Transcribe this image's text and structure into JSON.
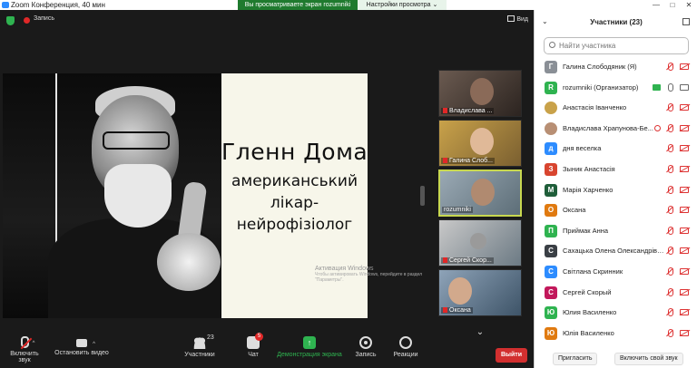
{
  "window": {
    "title": "Zoom Конференция, 40 мин",
    "controls": [
      "—",
      "□",
      "✕"
    ]
  },
  "share_banner": {
    "text": "Вы просматриваете экран rozumniki",
    "options_label": "Настройки просмотра ⌄"
  },
  "topbar": {
    "record_label": "Запись",
    "view_label": "Вид"
  },
  "slide": {
    "title": "Гленн Доман",
    "subtitle_lines": [
      "американський",
      "лікар-",
      "нейрофізіолог"
    ],
    "watermark_title": "Активация Windows",
    "watermark_text": "Чтобы активировать Windows, перейдите в раздел \"Параметры\"."
  },
  "thumbnails": [
    {
      "name": "Владислава ...",
      "muted": true
    },
    {
      "name": "Галина Слоб...",
      "muted": true
    },
    {
      "name": "rozumniki",
      "muted": false,
      "active": true
    },
    {
      "name": "Сергей Скор...",
      "muted": true
    },
    {
      "name": "Оксана",
      "muted": true
    }
  ],
  "toolbar": {
    "mute_label": "Включить звук",
    "video_label": "Остановить видео",
    "participants_label": "Участники",
    "participants_count": "23",
    "chat_label": "Чат",
    "chat_badge": "5",
    "share_label": "Демонстрация экрана",
    "record_label": "Запись",
    "reactions_label": "Реакции",
    "leave_label": "Выйти",
    "share_icon": "↑"
  },
  "panel": {
    "title": "Участники (23)",
    "search_placeholder": "Найти участника",
    "invite_label": "Пригласить",
    "unmute_label": "Включить свой звук",
    "participants": [
      {
        "initial": "Г",
        "name": "Галина Слободяник (Я)",
        "color": "#8a8f96",
        "mic": "off",
        "video": "off"
      },
      {
        "initial": "R",
        "name": "rozumniki (Организатор)",
        "color": "#2fb350",
        "mic": "on",
        "video": "on",
        "sharing": true
      },
      {
        "initial": "",
        "name": "Анастасія Іванченко",
        "color": "#c9a24a",
        "mic": "off",
        "video": "off",
        "photo": true
      },
      {
        "initial": "",
        "name": "Владислава Храпунова-Бе...",
        "color": "#b88f74",
        "mic": "off",
        "video": "off",
        "photo": true,
        "recording": true
      },
      {
        "initial": "д",
        "name": "дня веселка",
        "color": "#2d8cff",
        "mic": "off",
        "video": "off"
      },
      {
        "initial": "З",
        "name": "Зыник Анастасія",
        "color": "#d8452f",
        "mic": "off",
        "video": "off"
      },
      {
        "initial": "М",
        "name": "Марія Харченко",
        "color": "#1f5e3a",
        "mic": "off",
        "video": "off"
      },
      {
        "initial": "О",
        "name": "Оксана",
        "color": "#e07a10",
        "mic": "off",
        "video": "off"
      },
      {
        "initial": "П",
        "name": "Приймак Анна",
        "color": "#2fb350",
        "mic": "off",
        "video": "off"
      },
      {
        "initial": "С",
        "name": "Сахацька Олена Олександрівна",
        "color": "#3a3f45",
        "mic": "off",
        "video": "off"
      },
      {
        "initial": "С",
        "name": "Світлана Скринник",
        "color": "#2d8cff",
        "mic": "off",
        "video": "off"
      },
      {
        "initial": "С",
        "name": "Сергей Скорый",
        "color": "#c2185b",
        "mic": "off",
        "video": "off"
      },
      {
        "initial": "Ю",
        "name": "Юлия Василенко",
        "color": "#2fb350",
        "mic": "off",
        "video": "off"
      },
      {
        "initial": "Ю",
        "name": "Юлія Василенко",
        "color": "#e07a10",
        "mic": "off",
        "video": "off"
      }
    ]
  }
}
